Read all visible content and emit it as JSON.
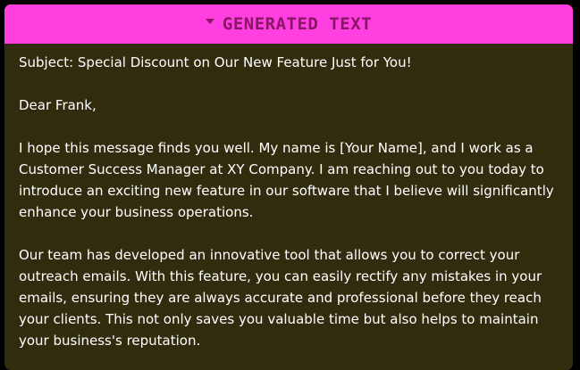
{
  "panel": {
    "title": "GENERATED TEXT",
    "icon": "caret-down-icon",
    "colors": {
      "header_bg": "#ff3fe0",
      "header_text": "#8b1569",
      "body_bg": "#322c0f",
      "body_text": "#ffffff"
    }
  },
  "email": {
    "subject": "Subject: Special Discount on Our New Feature Just for You!",
    "greeting": "Dear Frank,",
    "paragraphs": [
      "I hope this message finds you well. My name is [Your Name], and I work as a Customer Success Manager at XY Company. I am reaching out to you today to introduce an exciting new feature in our software that I believe will significantly enhance your business operations.",
      "Our team has developed an innovative tool that allows you to correct your outreach emails. With this feature, you can easily rectify any mistakes in your emails, ensuring they are always accurate and professional before they reach your clients. This not only saves you valuable time but also helps to maintain your business's reputation."
    ]
  }
}
